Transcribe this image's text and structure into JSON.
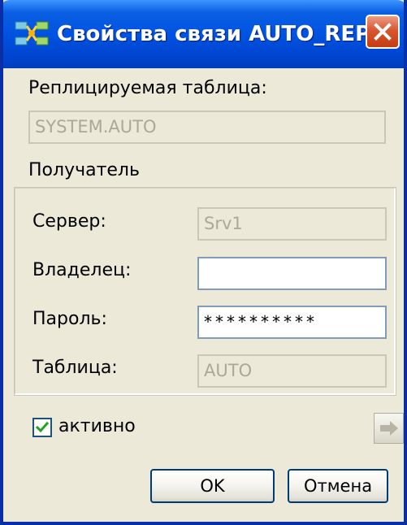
{
  "window": {
    "title": "Свойства связи AUTO_REPL",
    "close_icon": "close-icon",
    "app_icon": "link-icon"
  },
  "replicated_table": {
    "label": "Реплицируемая таблица:",
    "value": "SYSTEM.AUTO"
  },
  "recipient": {
    "label": "Получатель",
    "server": {
      "label": "Сервер:",
      "value": "Srv1"
    },
    "owner": {
      "label": "Владелец:",
      "value": ""
    },
    "password": {
      "label": "Пароль:",
      "value": "**********"
    },
    "table": {
      "label": "Таблица:",
      "value": "AUTO"
    }
  },
  "active": {
    "label": "активно",
    "checked": true
  },
  "buttons": {
    "ok": "OK",
    "cancel": "Отмена",
    "arrow_icon": "arrow-right-icon"
  },
  "colors": {
    "dialog_bg": "#ECE9D8",
    "titlebar_blue": "#0053E1",
    "close_red": "#D9572F",
    "field_border": "#7F9DB9",
    "disabled_text": "#ACA899"
  }
}
